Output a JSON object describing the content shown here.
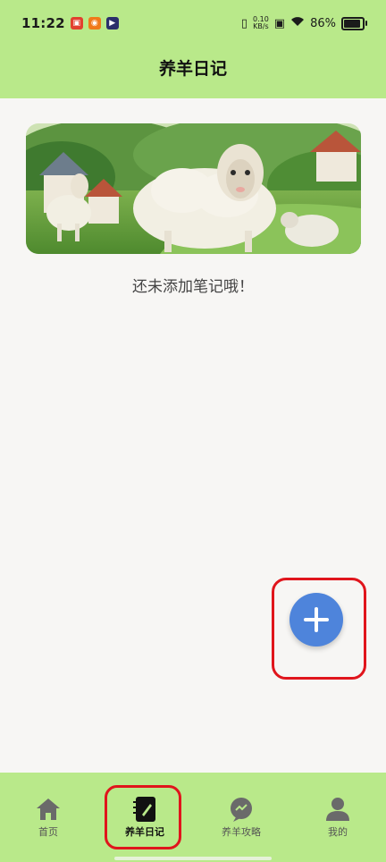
{
  "status_bar": {
    "time": "11:22",
    "speed_value": "0.10",
    "speed_unit": "KB/s",
    "battery": "86%"
  },
  "header": {
    "title": "养羊日记"
  },
  "banner": {
    "image": "sheep-farm-illustration"
  },
  "main": {
    "empty_message": "还未添加笔记哦！"
  },
  "fab": {
    "icon": "plus-icon",
    "color": "#4e84db"
  },
  "nav": {
    "items": [
      {
        "label": "首页",
        "icon": "home-icon"
      },
      {
        "label": "养羊日记",
        "icon": "notebook-icon",
        "active": true
      },
      {
        "label": "养羊攻略",
        "icon": "chat-icon"
      },
      {
        "label": "我的",
        "icon": "person-icon"
      }
    ]
  },
  "colors": {
    "header_bg": "#b9e98a",
    "nav_bg": "#b9e98a",
    "page_bg": "#f7f6f4",
    "highlight": "#e0151c"
  }
}
